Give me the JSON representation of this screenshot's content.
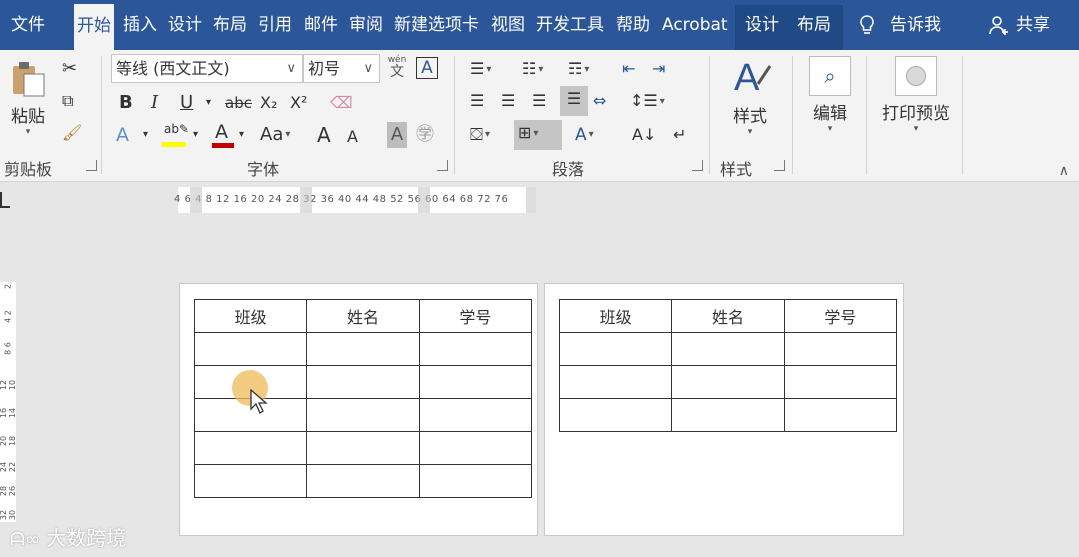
{
  "tabs": [
    "文件",
    "开始",
    "插入",
    "设计",
    "布局",
    "引用",
    "邮件",
    "审阅",
    "新建选项卡",
    "视图",
    "开发工具",
    "帮助",
    "Acrobat",
    "设计",
    "布局"
  ],
  "active_tab": "开始",
  "tell_me": "告诉我",
  "share": "共享",
  "clipboard": {
    "paste": "粘贴",
    "label": "剪贴板"
  },
  "font": {
    "name": "等线 (西文正文)",
    "size": "初号",
    "wen": "wén",
    "wen_char": "文",
    "a_box": "A",
    "bold": "B",
    "italic": "I",
    "underline": "U",
    "strike": "abc",
    "sub": "X₂",
    "sup": "X²",
    "case": "Aa",
    "grow": "A",
    "shrink": "A",
    "label": "字体"
  },
  "paragraph": {
    "label": "段落"
  },
  "styles": {
    "button": "样式",
    "label": "样式"
  },
  "editing": {
    "button": "编辑"
  },
  "print": {
    "button": "打印预览"
  },
  "ruler": {
    "ticks": "4  6  4  8  12 16 20  24  28 32 36 40 44  48 52 56 60 64 68 72  76"
  },
  "vruler": [
    "2",
    "4 2",
    "8 6",
    "12 10",
    "16 14",
    "20 18",
    "24 22",
    "28 26",
    "32 30"
  ],
  "table1": {
    "headers": [
      "班级",
      "姓名",
      "学号"
    ],
    "rows": 5
  },
  "table2": {
    "headers": [
      "班级",
      "姓名",
      "学号"
    ],
    "rows": 3
  },
  "watermark": "大数跨境",
  "colors": {
    "brand": "#2b579a",
    "highlight": "#ffff00",
    "font_color": "#c00000"
  }
}
